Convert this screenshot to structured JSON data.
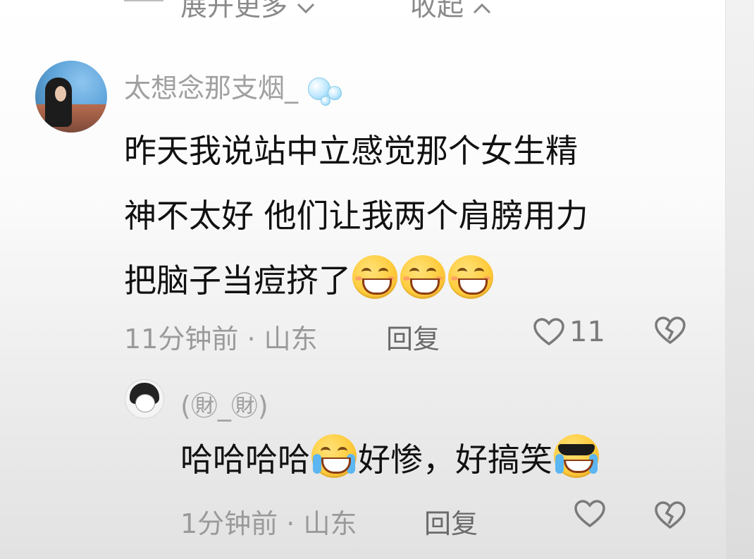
{
  "top_bar": {
    "expand_label": "展开更多",
    "expand_icon": "chevron-down-icon",
    "collapse_label": "收起",
    "collapse_icon": "chevron-up-icon"
  },
  "comments": [
    {
      "username": "太想念那支烟_",
      "username_decoration": "bubbles-icon",
      "text_line1": "昨天我说站中立感觉那个女生精",
      "text_line2": "神不太好 他们让我两个肩膀用力",
      "text_line3": "把脑子当痘挤了",
      "emojis": [
        "grin-emoji",
        "grin-emoji",
        "grin-emoji"
      ],
      "time": "11分钟前",
      "location": "山东",
      "meta_separator": " · ",
      "reply_label": "回复",
      "like_count": "11"
    },
    {
      "username": "(㊖_㊖)",
      "text_part1": "哈哈哈哈",
      "emoji1": "tears-of-joy-emoji",
      "text_part2": "好惨，好搞笑",
      "emoji2": "sunglasses-tears-emoji",
      "time": "1分钟前",
      "location": "山东",
      "meta_separator": " · ",
      "reply_label": "回复"
    }
  ],
  "colors": {
    "username": "#a0a0a0",
    "text": "#111111",
    "meta": "#9a9a9a",
    "icon": "#7a7a7a"
  }
}
